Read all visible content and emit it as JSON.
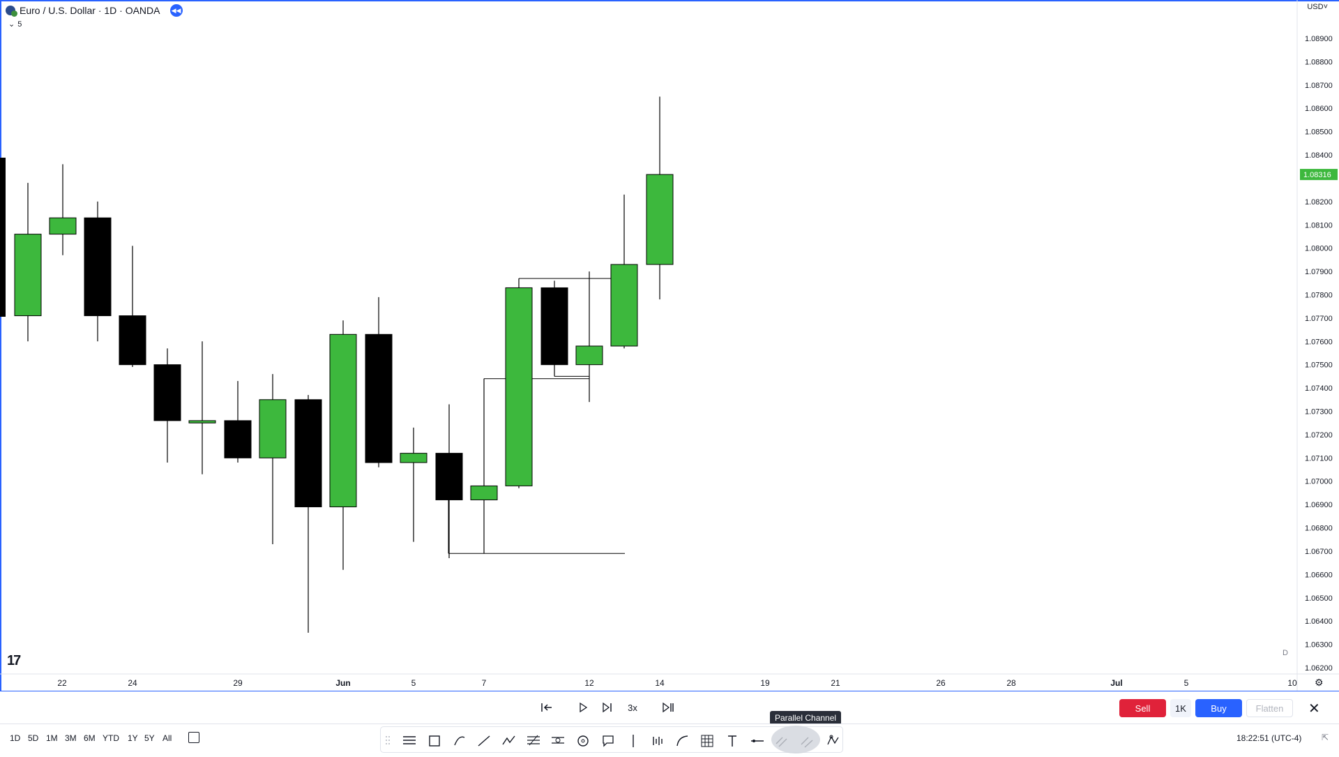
{
  "legend": {
    "symbol_title": "Euro / U.S. Dollar · 1D · OANDA",
    "collapse_count": "5",
    "flag_icon": "eur-usd-flag-icon",
    "replay_icon": "rewind-icon"
  },
  "price_scale": {
    "currency": "USD",
    "labels": [
      "1.08900",
      "1.08800",
      "1.08700",
      "1.08600",
      "1.08500",
      "1.08400",
      "1.08200",
      "1.08100",
      "1.08000",
      "1.07900",
      "1.07800",
      "1.07700",
      "1.07600",
      "1.07500",
      "1.07400",
      "1.07300",
      "1.07200",
      "1.07100",
      "1.07000",
      "1.06900",
      "1.06800",
      "1.06700",
      "1.06600",
      "1.06500",
      "1.06400",
      "1.06300",
      "1.06200"
    ],
    "current_price": "1.08316",
    "current_price_color": "#3db83d"
  },
  "time_scale": {
    "labels": [
      "22",
      "24",
      "29",
      "Jun",
      "5",
      "7",
      "12",
      "14",
      "19",
      "21",
      "26",
      "28",
      "Jul",
      "5",
      "10"
    ]
  },
  "chart_data": {
    "type": "candlestick",
    "symbol": "Euro / U.S. Dollar",
    "interval": "1D",
    "up_color": "#3db83d",
    "down_color": "#000000",
    "ylim": [
      1.0618,
      1.0905
    ],
    "candles": [
      {
        "x": "May 19",
        "open": 1.0771,
        "high": 1.0828,
        "low": 1.076,
        "close": 1.0806
      },
      {
        "x": "May 22",
        "open": 1.0806,
        "high": 1.0836,
        "low": 1.0797,
        "close": 1.0813
      },
      {
        "x": "May 23",
        "open": 1.0813,
        "high": 1.082,
        "low": 1.076,
        "close": 1.0771
      },
      {
        "x": "May 24",
        "open": 1.0771,
        "high": 1.0801,
        "low": 1.0749,
        "close": 1.075
      },
      {
        "x": "May 25",
        "open": 1.075,
        "high": 1.0757,
        "low": 1.0708,
        "close": 1.0726
      },
      {
        "x": "May 26",
        "open": 1.0725,
        "high": 1.076,
        "low": 1.0703,
        "close": 1.0726
      },
      {
        "x": "May 29",
        "open": 1.0726,
        "high": 1.0743,
        "low": 1.0708,
        "close": 1.071
      },
      {
        "x": "May 30",
        "open": 1.071,
        "high": 1.0746,
        "low": 1.0673,
        "close": 1.0735
      },
      {
        "x": "May 31",
        "open": 1.0735,
        "high": 1.0737,
        "low": 1.0635,
        "close": 1.0689
      },
      {
        "x": "Jun 1",
        "open": 1.0689,
        "high": 1.0769,
        "low": 1.0662,
        "close": 1.0763
      },
      {
        "x": "Jun 2",
        "open": 1.0763,
        "high": 1.0779,
        "low": 1.0706,
        "close": 1.0708
      },
      {
        "x": "Jun 5",
        "open": 1.0708,
        "high": 1.0723,
        "low": 1.0674,
        "close": 1.0712
      },
      {
        "x": "Jun 6",
        "open": 1.0712,
        "high": 1.0733,
        "low": 1.0667,
        "close": 1.0692
      },
      {
        "x": "Jun 7",
        "open": 1.0692,
        "high": 1.0744,
        "low": 1.0669,
        "close": 1.0698
      },
      {
        "x": "Jun 8",
        "open": 1.0698,
        "high": 1.0787,
        "low": 1.0697,
        "close": 1.0783
      },
      {
        "x": "Jun 9",
        "open": 1.0783,
        "high": 1.0786,
        "low": 1.0745,
        "close": 1.075
      },
      {
        "x": "Jun 12",
        "open": 1.075,
        "high": 1.079,
        "low": 1.0734,
        "close": 1.0758
      },
      {
        "x": "Jun 13",
        "open": 1.0758,
        "high": 1.0823,
        "low": 1.0757,
        "close": 1.0793
      },
      {
        "x": "Jun 14",
        "open": 1.0793,
        "high": 1.0865,
        "low": 1.0778,
        "close": 1.08316
      }
    ]
  },
  "replay_bar": {
    "jump_back_icon": "jump-to-bar-icon",
    "play_icon": "play-icon",
    "step_forward_icon": "step-forward-icon",
    "speed_label": "3x",
    "jump_realtime_icon": "jump-to-realtime-icon",
    "tooltip": "Parallel Channel",
    "sell_label": "Sell",
    "quantity_label": "1K",
    "buy_label": "Buy",
    "flatten_label": "Flatten",
    "close_icon": "close-icon"
  },
  "bottom_bar": {
    "ranges": [
      "1D",
      "5D",
      "1M",
      "3M",
      "6M",
      "YTD",
      "1Y",
      "5Y",
      "All"
    ],
    "calendar_icon": "calendar-icon",
    "clock": "18:22:51 (UTC-4)",
    "drawing_tools": [
      "drag-handle-icon",
      "horizontal-lines-icon",
      "rectangle-icon",
      "brush-icon",
      "trend-line-icon",
      "polyline-icon",
      "fib-channel-icon",
      "gann-icon",
      "circle-icon",
      "callout-icon",
      "vertical-line-icon",
      "long-position-icon",
      "curve-icon",
      "grid-icon",
      "text-icon",
      "horizontal-ray-icon",
      "parallel-channel-icon",
      "parallel-channel-active-icon",
      "pattern-icon"
    ]
  }
}
